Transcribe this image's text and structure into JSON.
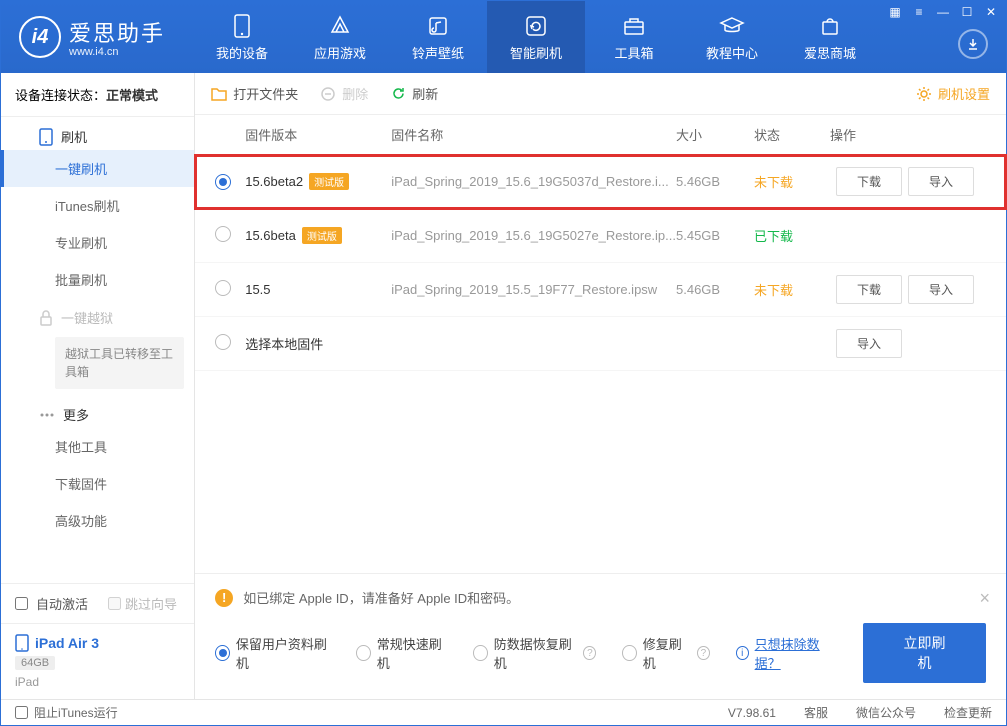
{
  "header": {
    "logo_text": "爱思助手",
    "logo_sub": "www.i4.cn",
    "nav": [
      {
        "label": "我的设备"
      },
      {
        "label": "应用游戏"
      },
      {
        "label": "铃声壁纸"
      },
      {
        "label": "智能刷机"
      },
      {
        "label": "工具箱"
      },
      {
        "label": "教程中心"
      },
      {
        "label": "爱思商城"
      }
    ]
  },
  "sidebar": {
    "status_label": "设备连接状态：",
    "status_value": "正常模式",
    "group_flash": "刷机",
    "items_flash": [
      {
        "label": "一键刷机"
      },
      {
        "label": "iTunes刷机"
      },
      {
        "label": "专业刷机"
      },
      {
        "label": "批量刷机"
      }
    ],
    "group_jailbreak": "一键越狱",
    "jailbreak_note": "越狱工具已转移至工具箱",
    "group_more": "更多",
    "items_more": [
      {
        "label": "其他工具"
      },
      {
        "label": "下载固件"
      },
      {
        "label": "高级功能"
      }
    ],
    "auto_activate": "自动激活",
    "skip_guide": "跳过向导",
    "device_name": "iPad Air 3",
    "device_storage": "64GB",
    "device_type": "iPad"
  },
  "toolbar": {
    "open_folder": "打开文件夹",
    "delete": "删除",
    "refresh": "刷新",
    "settings": "刷机设置"
  },
  "table": {
    "head": {
      "version": "固件版本",
      "name": "固件名称",
      "size": "大小",
      "status": "状态",
      "action": "操作"
    },
    "rows": [
      {
        "selected": true,
        "version": "15.6beta2",
        "beta": "测试版",
        "name": "iPad_Spring_2019_15.6_19G5037d_Restore.i...",
        "size": "5.46GB",
        "status": "未下载",
        "status_key": "not",
        "actions": [
          "下载",
          "导入"
        ],
        "highlighted": true
      },
      {
        "selected": false,
        "version": "15.6beta",
        "beta": "测试版",
        "name": "iPad_Spring_2019_15.6_19G5027e_Restore.ip...",
        "size": "5.45GB",
        "status": "已下载",
        "status_key": "ok",
        "actions": []
      },
      {
        "selected": false,
        "version": "15.5",
        "beta": null,
        "name": "iPad_Spring_2019_15.5_19F77_Restore.ipsw",
        "size": "5.46GB",
        "status": "未下载",
        "status_key": "not",
        "actions": [
          "下载",
          "导入"
        ]
      },
      {
        "selected": false,
        "version": "选择本地固件",
        "beta": null,
        "name": "",
        "size": "",
        "status": "",
        "status_key": "",
        "actions": [
          "导入"
        ]
      }
    ]
  },
  "bottom": {
    "alert": "如已绑定 Apple ID，请准备好 Apple ID和密码。",
    "options": [
      {
        "label": "保留用户资料刷机",
        "selected": true
      },
      {
        "label": "常规快速刷机"
      },
      {
        "label": "防数据恢复刷机",
        "help": true
      },
      {
        "label": "修复刷机",
        "help": true
      }
    ],
    "erase_link": "只想抹除数据？",
    "flash_btn": "立即刷机"
  },
  "footer": {
    "block_itunes": "阻止iTunes运行",
    "version": "V7.98.61",
    "service": "客服",
    "wechat": "微信公众号",
    "check_update": "检查更新"
  }
}
